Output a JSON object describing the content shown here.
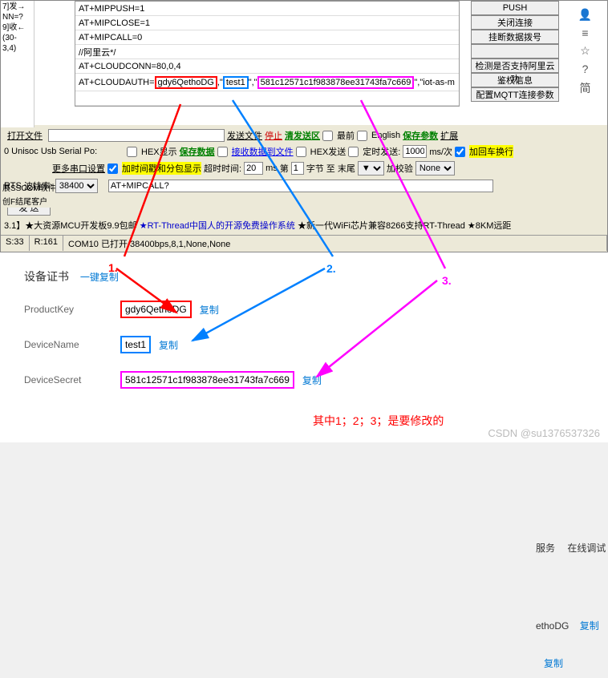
{
  "left_strip": [
    "7]发→",
    "NN=?",
    "9]收←",
    "(30-",
    "3,4)"
  ],
  "cmds": [
    "AT+MIPPUSH=1",
    "AT+MIPCLOSE=1",
    "AT+MIPCALL=0",
    "//阿里云*/",
    "AT+CLOUDCONN=80,0,4"
  ],
  "auth_line": {
    "prefix": "AT+CLOUDAUTH=",
    "pk": "gdy6QethoDG",
    "dn": "test1",
    "ds": "581c12571c1f983878ee31743fa7c669",
    "suffix": "\"iot-as-m"
  },
  "btns": [
    "PUSH",
    "关闭连接",
    "挂断数据拨号",
    "",
    "检测是否支持阿里云功",
    "鉴权信息",
    "配置MQTT连接参数"
  ],
  "right_icons": [
    "👤",
    "≡",
    "☆",
    "?",
    "简"
  ],
  "tb1": {
    "open": "打开文件",
    "send": "发送文件",
    "stop": "停止",
    "clear_send": "清发送区",
    "latest": "最前",
    "english": "English",
    "save_param": "保存参数",
    "expand": "扩展"
  },
  "tb2": {
    "port": "0 Unisoc Usb Serial Po:",
    "hex_disp": "HEX显示",
    "save_data": "保存数据",
    "recv_file": "接收数据到文件",
    "hex_send": "HEX发送",
    "timed_send": "定时发送:",
    "interval": "1000",
    "ms": "ms/次",
    "add_cr": "加回车换行"
  },
  "tb3": {
    "more": "更多串口设置",
    "time_pkt": "加时间戳和分包显示",
    "timeout_lbl": "超时时间:",
    "timeout": "20",
    "ms": "ms",
    "frame": "第",
    "frame_n": "1",
    "byte": "字节 至 末尾",
    "checksum": "加校验",
    "checksum_v": "None"
  },
  "tb4": {
    "rts": "RTS",
    "baud_lbl": "波特率:",
    "baud": "38400",
    "input": "AT+MIPCALL?"
  },
  "tb_left": {
    "port_btn": "口",
    "sscom": "展SSCOM软件",
    "f_end": "创F结尾客户"
  },
  "send_btn": "发 送",
  "banner": {
    "a": "3.1】",
    "b": "★大资源MCU开发板9.9包邮",
    "c": "★RT-Thread中国人的开源免费操作系统",
    "d": "★新一代WiFi芯片兼容8266支持RT-Thread",
    "e": "★8KM远距"
  },
  "status": {
    "s": "S:33",
    "r": "R:161",
    "info": "COM10 已打开  38400bps,8,1,None,None"
  },
  "cert": {
    "title": "设备证书",
    "copy_all": "一键复制",
    "rows": [
      {
        "label": "ProductKey",
        "value": "gdy6QethoDG",
        "box": "box-red"
      },
      {
        "label": "DeviceName",
        "value": "test1",
        "box": "box-blue"
      },
      {
        "label": "DeviceSecret",
        "value": "581c12571c1f983878ee31743fa7c669",
        "box": "box-mag"
      }
    ],
    "copy": "复制"
  },
  "nums": {
    "n1": "1.",
    "n2": "2.",
    "n3": "3."
  },
  "right_side": {
    "svc": "服务",
    "debug": "在线调试",
    "etho": "ethoDG",
    "copy": "复制"
  },
  "footer": "其中1；2；3；是要修改的",
  "watermark": "CSDN @su1376537326"
}
